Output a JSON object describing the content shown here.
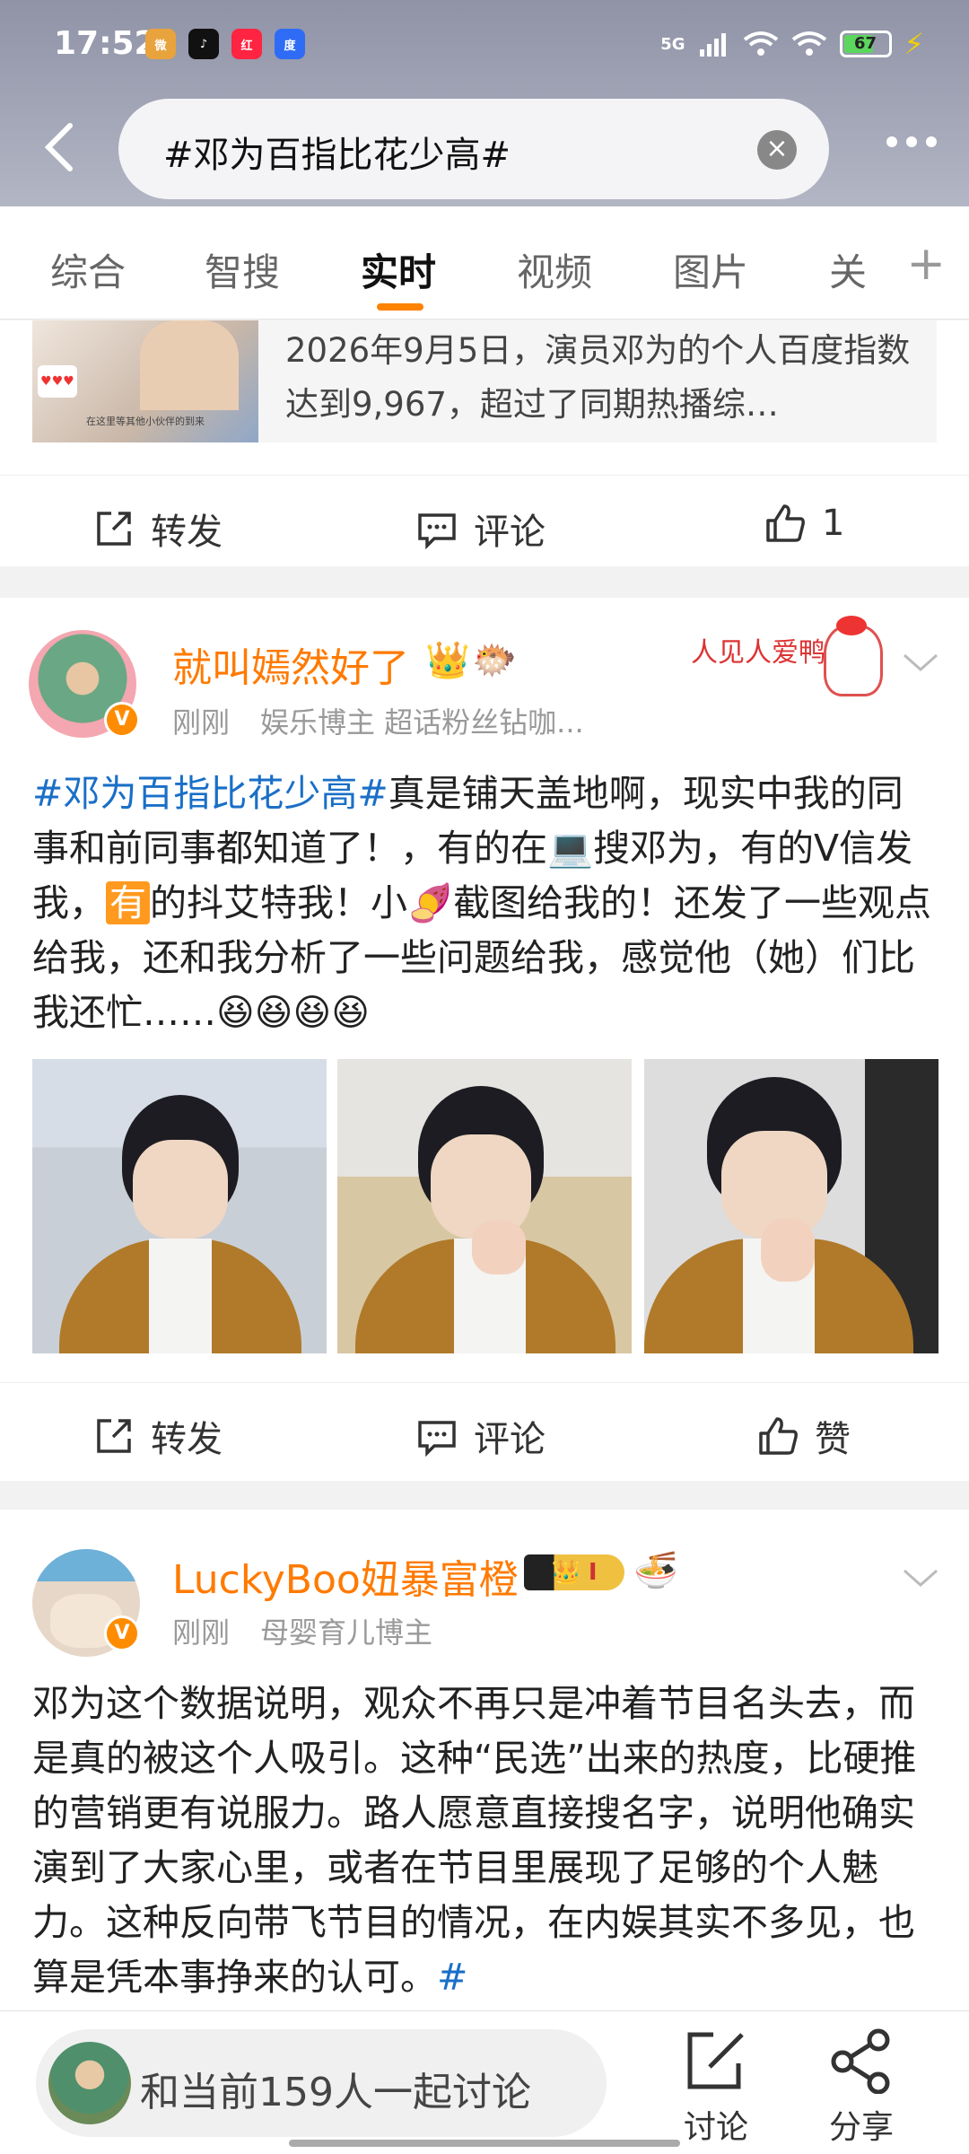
{
  "status_bar": {
    "time": "17:52",
    "network": "5G",
    "battery": "67",
    "battery_level": 0.67,
    "app_icons": [
      "weibo-icon",
      "tiktok-icon",
      "xiaohongshu-icon",
      "baidu-icon"
    ]
  },
  "search": {
    "query": "#邓为百指比花少高#"
  },
  "tabs": [
    {
      "label": "综合"
    },
    {
      "label": "智搜"
    },
    {
      "label": "实时",
      "active": true
    },
    {
      "label": "视频"
    },
    {
      "label": "图片"
    },
    {
      "label": "关"
    }
  ],
  "colors": {
    "accent": "#ff8200",
    "username": "#ff7a00",
    "hashtag": "#1a6fc7"
  },
  "post1": {
    "repost_text": "2026年9月5日，演员邓为的个人百度指数达到9,967，超过了同期热播综…",
    "thumb_caption": "在这里等其他小伙伴的到来",
    "actions": {
      "repost": "转发",
      "comment": "评论",
      "like": "1"
    }
  },
  "post2": {
    "username": "就叫嫣然好了",
    "time": "刚刚",
    "meta": "娱乐博主 超话粉丝钻咖...",
    "sticker_text": "人见人爱鸭",
    "text_tag": "#邓为百指比花少高#",
    "text_part1": "真是铺天盖地啊，现实中我的同事和前同事都知道了！，有的在",
    "text_part2": "搜邓为，有的V信发我，",
    "text_highlight": "有",
    "text_part3": "的抖艾特我！小",
    "text_part4": "截图给我的！还发了一些观点给我，还和我分析了一些问题给我，感觉他（她）们比我还忙……",
    "emoji": "😆😆😆😆",
    "actions": {
      "repost": "转发",
      "comment": "评论",
      "like": "赞"
    }
  },
  "post3": {
    "username": "LuckyBoo妞暴富橙",
    "time": "刚刚",
    "meta": "母婴育儿博主",
    "text": "邓为这个数据说明，观众不再只是冲着节目名头去，而是真的被这个人吸引。这种“民选”出来的热度，比硬推的营销更有说服力。路人愿意直接搜名字，说明他确实演到了大家心里，或者在节目里展现了足够的个人魅力。这种反向带飞节目的情况，在内娱其实不多见，也算是凭本事挣来的认可。",
    "tail_tag": "#"
  },
  "bottom_bar": {
    "discuss_text": "和当前159人一起讨论",
    "discuss_label": "讨论",
    "share_label": "分享"
  }
}
